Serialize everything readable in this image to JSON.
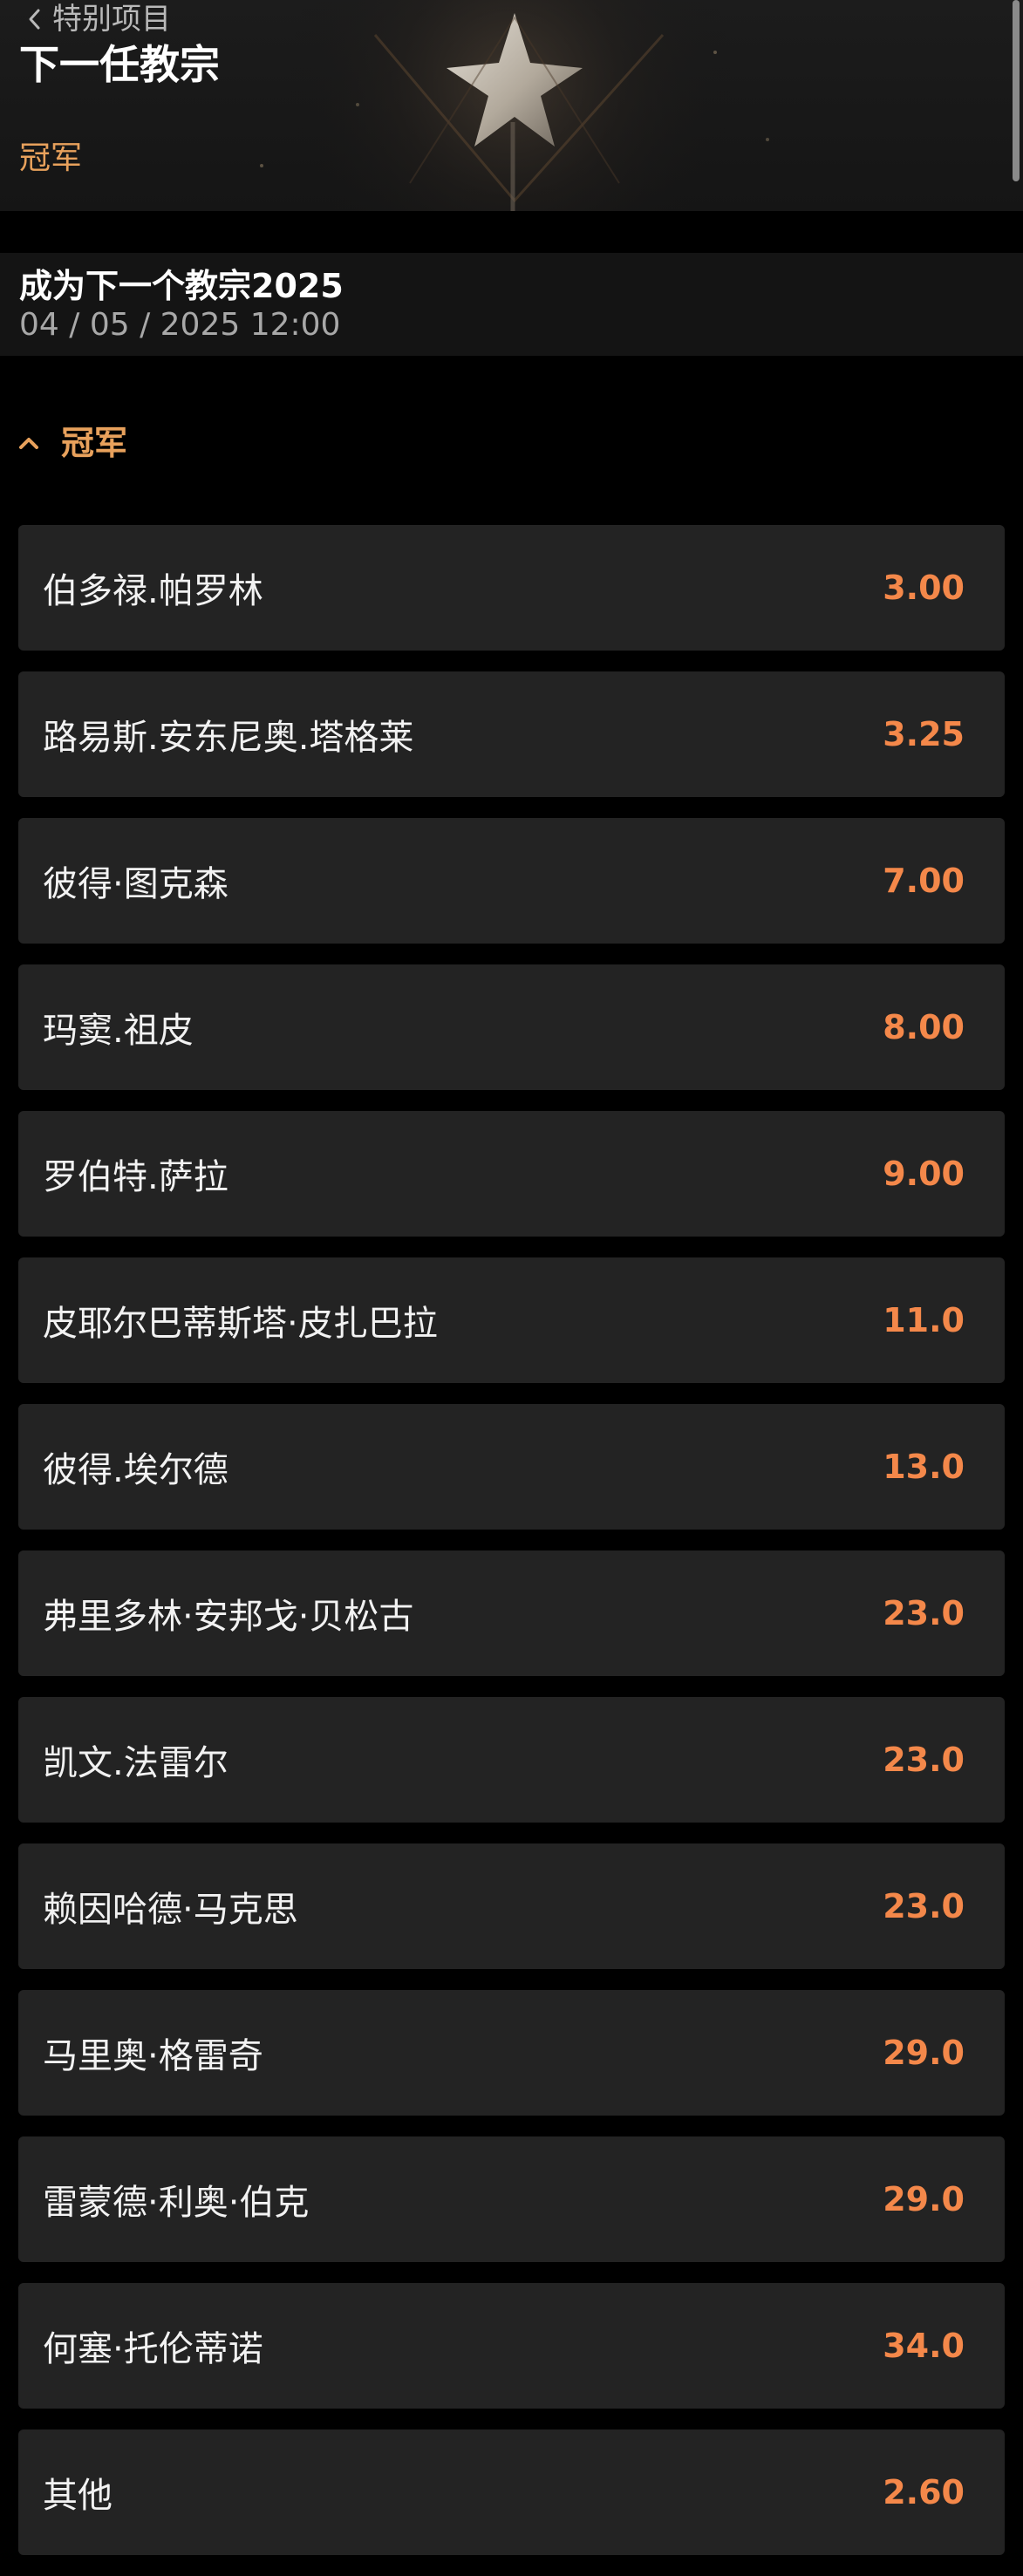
{
  "header": {
    "back_label": "特别项目",
    "title": "下一任教宗",
    "tag": "冠军"
  },
  "event": {
    "name": "成为下一个教宗2025",
    "date": "04 / 05 / 2025 12:00"
  },
  "market": {
    "title": "冠军",
    "expanded": true
  },
  "outcomes": [
    {
      "name": "伯多禄.帕罗林",
      "odds": "3.00"
    },
    {
      "name": "路易斯.安东尼奥.塔格莱",
      "odds": "3.25"
    },
    {
      "name": "彼得·图克森",
      "odds": "7.00"
    },
    {
      "name": "玛窦.祖皮",
      "odds": "8.00"
    },
    {
      "name": "罗伯特.萨拉",
      "odds": "9.00"
    },
    {
      "name": "皮耶尔巴蒂斯塔·皮扎巴拉",
      "odds": "11.0"
    },
    {
      "name": "彼得.埃尔德",
      "odds": "13.0"
    },
    {
      "name": "弗里多林·安邦戈·贝松古",
      "odds": "23.0"
    },
    {
      "name": "凯文.法雷尔",
      "odds": "23.0"
    },
    {
      "name": "赖因哈德·马克思",
      "odds": "23.0"
    },
    {
      "name": "马里奥·格雷奇",
      "odds": "29.0"
    },
    {
      "name": "雷蒙德·利奥·伯克",
      "odds": "29.0"
    },
    {
      "name": "何塞·托伦蒂诺",
      "odds": "34.0"
    },
    {
      "name": "其他",
      "odds": "2.60"
    }
  ],
  "colors": {
    "accent": "#e8a15c",
    "odds": "#f4884a",
    "row_bg": "#232323",
    "page_bg": "#000000"
  },
  "icons": {
    "back": "chevron-left-icon",
    "collapse": "chevron-up-icon",
    "banner": "star-icon"
  }
}
